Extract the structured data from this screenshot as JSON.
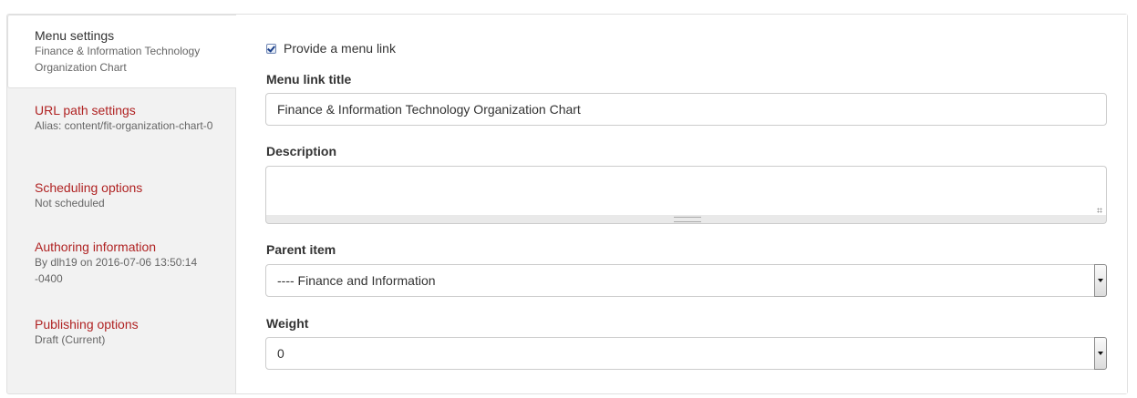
{
  "tabs": [
    {
      "title": "Menu settings",
      "summary": "Finance & Information Technology Organization Chart"
    },
    {
      "title": "URL path settings",
      "summary": "Alias: content/fit-organization-chart-0"
    },
    {
      "title": "Scheduling options",
      "summary": "Not scheduled"
    },
    {
      "title": "Authoring information",
      "summary": "By dlh19 on 2016-07-06 13:50:14 -0400"
    },
    {
      "title": "Publishing options",
      "summary": "Draft (Current)"
    }
  ],
  "menu": {
    "provide_link_label": "Provide a menu link",
    "provide_link_checked": true,
    "title_label": "Menu link title",
    "title_value": "Finance & Information Technology Organization Chart",
    "description_label": "Description",
    "description_value": "",
    "parent_label": "Parent item",
    "parent_value": "---- Finance and Information",
    "weight_label": "Weight",
    "weight_value": "0"
  },
  "colors": {
    "link": "#b02323",
    "sidebar_bg": "#f2f2f2",
    "panel_bg": "#ffffff"
  }
}
